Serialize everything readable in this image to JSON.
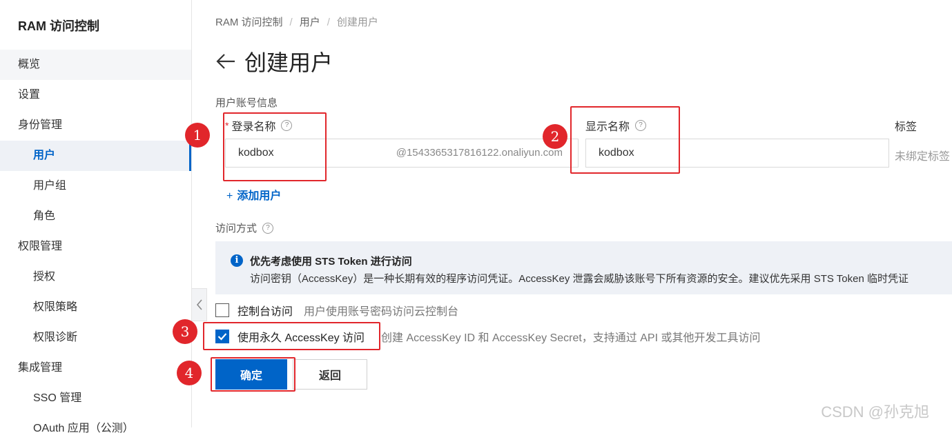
{
  "sidebar": {
    "title": "RAM 访问控制",
    "items": [
      {
        "label": "概览"
      },
      {
        "label": "设置"
      },
      {
        "label": "身份管理"
      },
      {
        "label": "用户"
      },
      {
        "label": "用户组"
      },
      {
        "label": "角色"
      },
      {
        "label": "权限管理"
      },
      {
        "label": "授权"
      },
      {
        "label": "权限策略"
      },
      {
        "label": "权限诊断"
      },
      {
        "label": "集成管理"
      },
      {
        "label": "SSO 管理"
      },
      {
        "label": "OAuth 应用（公测）"
      }
    ],
    "active_item": "用户",
    "collapse_icon": "chevron-left-icon"
  },
  "breadcrumb": [
    "RAM 访问控制",
    "用户",
    "创建用户"
  ],
  "page_title": "创建用户",
  "account_section": {
    "label": "用户账号信息",
    "login_name_label": "登录名称",
    "login_name_value": "kodbox",
    "login_name_suffix": "@1543365317816122.onaliyun.com",
    "display_name_label": "显示名称",
    "display_name_value": "kodbox",
    "tags_label": "标签",
    "tags_placeholder": "未绑定标签",
    "add_user": "添加用户",
    "help_glyph": "?"
  },
  "access_section": {
    "label": "访问方式",
    "alert_icon": "i",
    "alert_title": "优先考虑使用 STS Token 进行访问",
    "alert_text": "访问密钥（AccessKey）是一种长期有效的程序访问凭证。AccessKey 泄露会威胁该账号下所有资源的安全。建议优先采用 STS Token 临时凭证",
    "console_label": "控制台访问",
    "console_desc": "用户使用账号密码访问云控制台",
    "console_checked": false,
    "accesskey_label": "使用永久 AccessKey 访问",
    "accesskey_desc": "创建 AccessKey ID 和 AccessKey Secret，支持通过 API 或其他开发工具访问",
    "accesskey_checked": true
  },
  "buttons": {
    "confirm": "确定",
    "back": "返回"
  },
  "annotations": [
    "1",
    "2",
    "3",
    "4"
  ],
  "watermark": "CSDN @孙克旭",
  "colors": {
    "primary": "#0064c8",
    "annotation": "#e1262b",
    "alert_bg": "#eef1f6"
  }
}
